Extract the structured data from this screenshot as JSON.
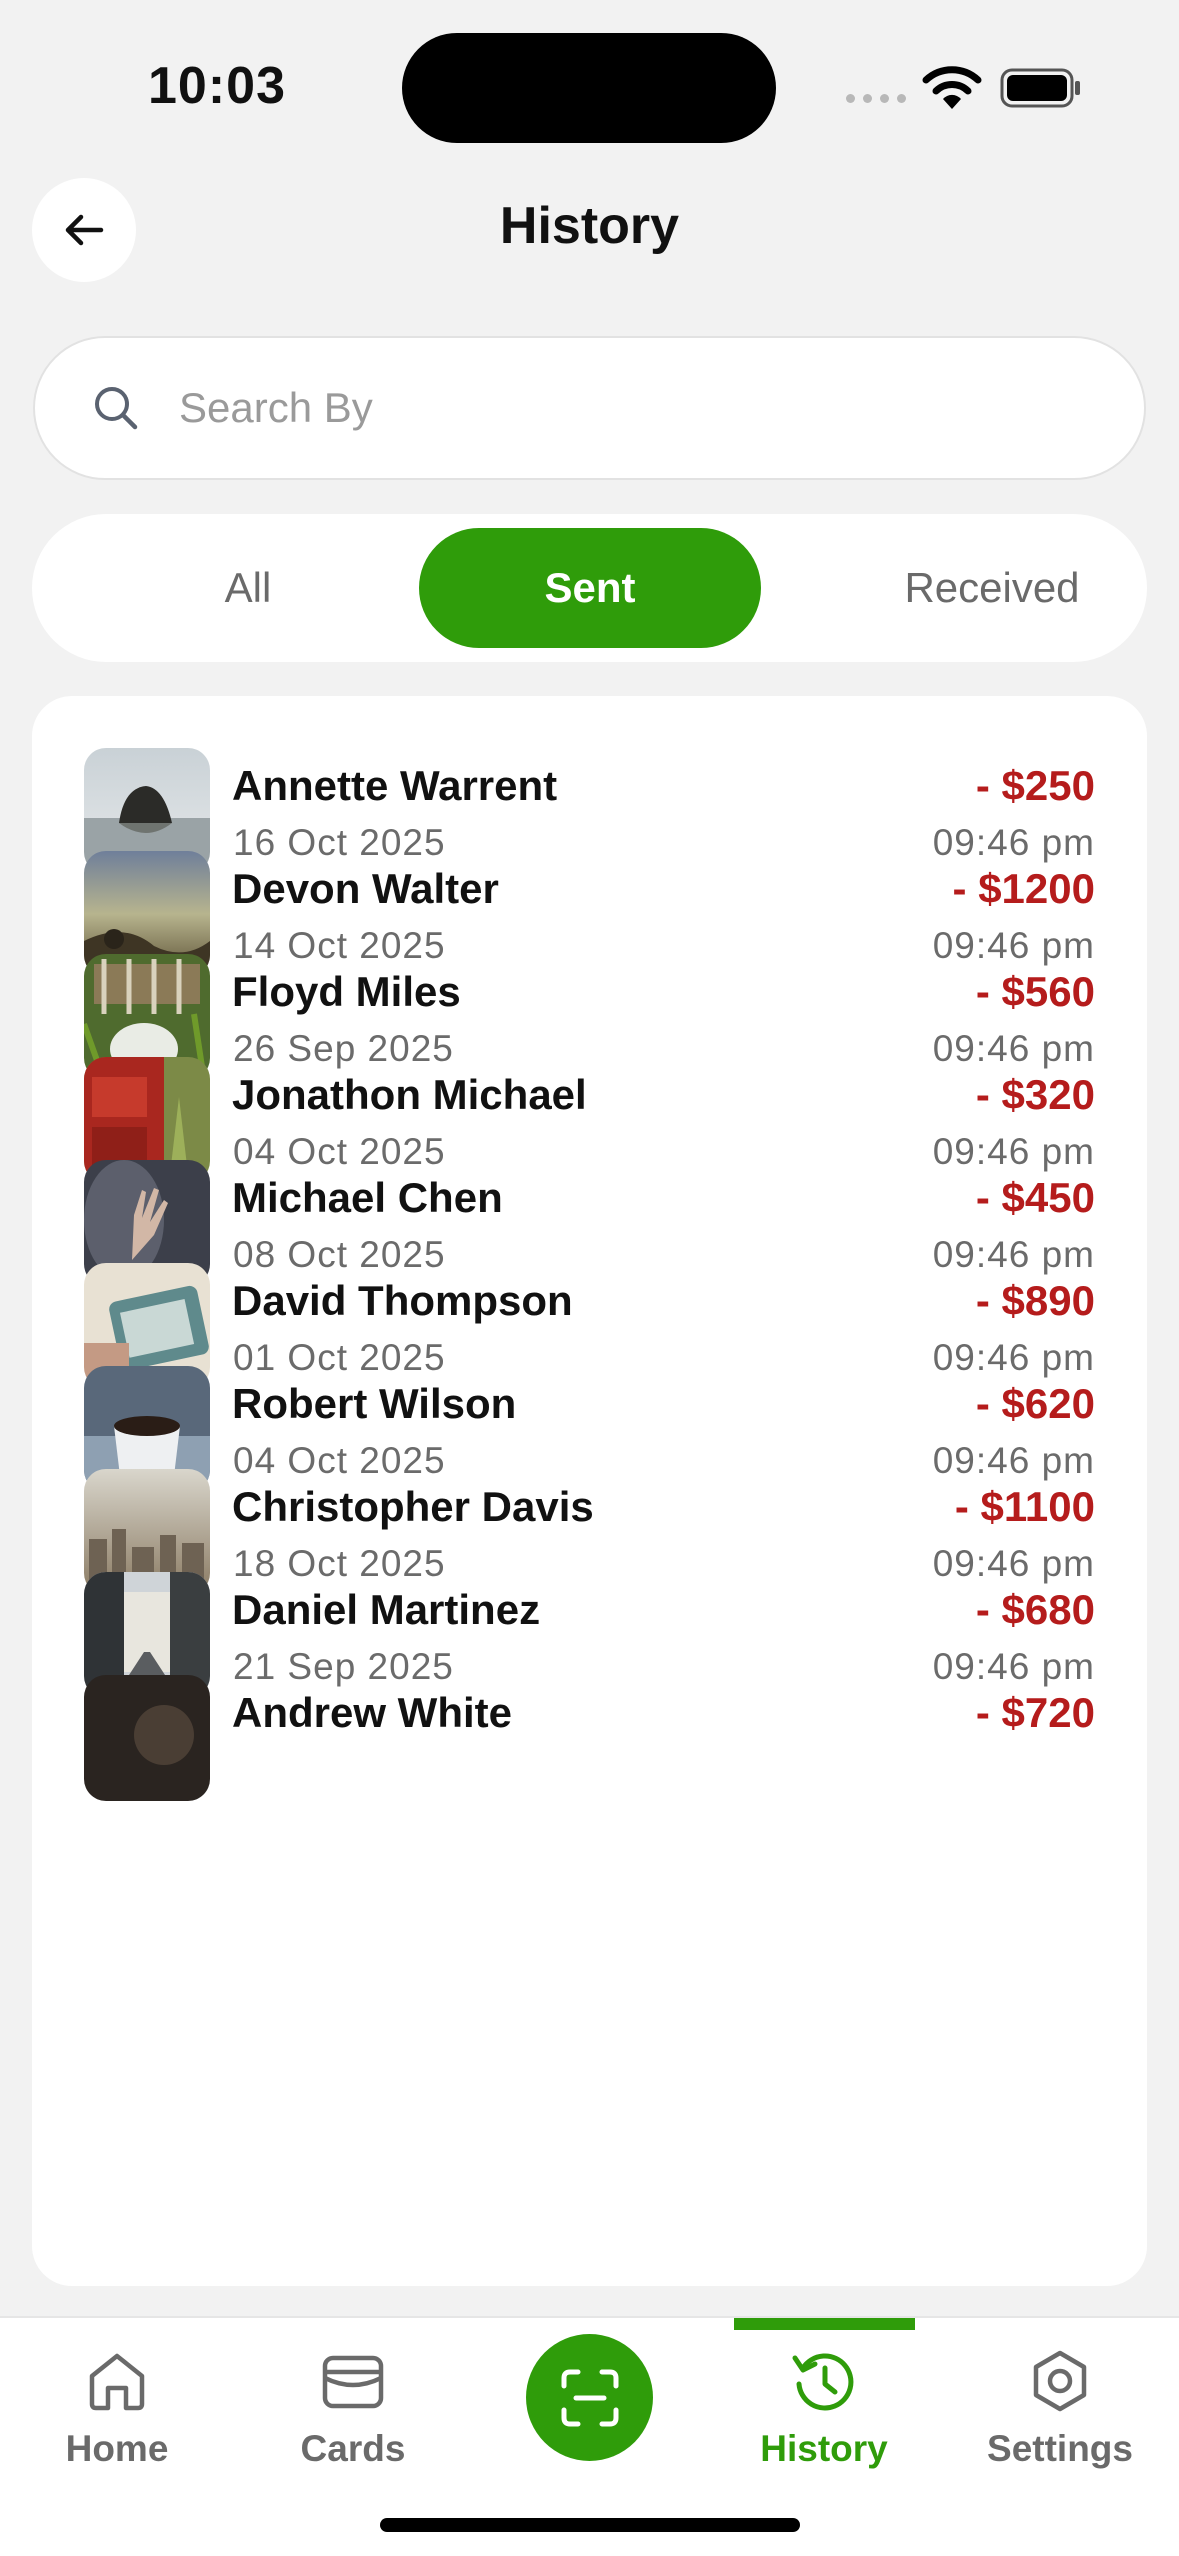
{
  "status_bar": {
    "time": "10:03"
  },
  "header": {
    "title": "History"
  },
  "search": {
    "placeholder": "Search By"
  },
  "tabs": [
    {
      "label": "All"
    },
    {
      "label": "Sent",
      "active": true
    },
    {
      "label": "Received"
    }
  ],
  "transactions": [
    {
      "name": "Annette Warrent",
      "date": "16 Oct 2025",
      "amount": "- $250",
      "time": "09:46 pm"
    },
    {
      "name": "Devon Walter",
      "date": "14 Oct 2025",
      "amount": "- $1200",
      "time": "09:46 pm"
    },
    {
      "name": "Floyd Miles",
      "date": "26 Sep 2025",
      "amount": "- $560",
      "time": "09:46 pm"
    },
    {
      "name": "Jonathon Michael",
      "date": "04 Oct 2025",
      "amount": "- $320",
      "time": "09:46 pm"
    },
    {
      "name": "Michael Chen",
      "date": "08 Oct 2025",
      "amount": "- $450",
      "time": "09:46 pm"
    },
    {
      "name": "David Thompson",
      "date": "01 Oct 2025",
      "amount": "- $890",
      "time": "09:46 pm"
    },
    {
      "name": "Robert Wilson",
      "date": "04 Oct 2025",
      "amount": "- $620",
      "time": "09:46 pm"
    },
    {
      "name": "Christopher Davis",
      "date": "18 Oct 2025",
      "amount": "- $1100",
      "time": "09:46 pm"
    },
    {
      "name": "Daniel Martinez",
      "date": "21 Sep 2025",
      "amount": "- $680",
      "time": "09:46 pm"
    },
    {
      "name": "Andrew White",
      "date": "",
      "amount": "- $720",
      "time": ""
    }
  ],
  "nav": {
    "home": "Home",
    "cards": "Cards",
    "history": "History",
    "settings": "Settings"
  },
  "colors": {
    "accent": "#2f9c0a",
    "debit": "#b51c1c",
    "background": "#f2f2f2"
  },
  "icons": {
    "back": "arrow-left-icon",
    "search": "search-icon",
    "home": "home-icon",
    "cards": "wallet-icon",
    "scan": "scan-icon",
    "history": "history-icon",
    "settings": "hexagon-settings-icon"
  }
}
